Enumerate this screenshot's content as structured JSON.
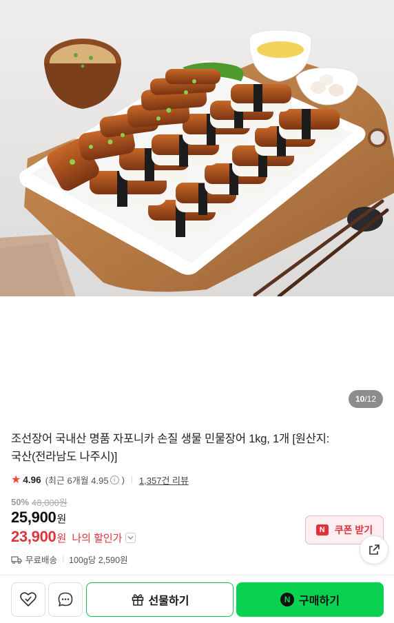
{
  "product": {
    "title_line1": "조선장어 국내산 명품 자포니카 손질 생물 민물장어 1kg, 1개 [원산지:",
    "title_line2": "국산(전라남도 나주시)]"
  },
  "gallery": {
    "current": "10",
    "total": "/12"
  },
  "rating": {
    "score": "4.96",
    "recent_label": "(최근 6개월 4.95",
    "recent_close": ")",
    "review_link": "1,357건 리뷰"
  },
  "pricing": {
    "discount_pct": "50%",
    "original_price": "48,000원",
    "sale_price": "25,900",
    "sale_unit": "원",
    "my_price": "23,900",
    "my_unit": "원",
    "my_label": "나의 할인가"
  },
  "coupon": {
    "badge": "N",
    "label": "쿠폰 받기"
  },
  "shipping": {
    "label": "무료배송",
    "unit_price": "100g당 2,590원"
  },
  "actions": {
    "gift_label": "선물하기",
    "buy_badge": "N",
    "buy_label": "구매하기"
  },
  "colors": {
    "accent_red": "#e1323c",
    "naver_green": "#08d24f",
    "star": "#f0453a"
  },
  "icons": {
    "wishlist": "heart-check-icon",
    "talk": "chat-bubble-icon",
    "gift": "gift-box-icon",
    "share": "share-icon",
    "shipping": "truck-icon",
    "star": "star-icon",
    "info": "info-icon"
  }
}
